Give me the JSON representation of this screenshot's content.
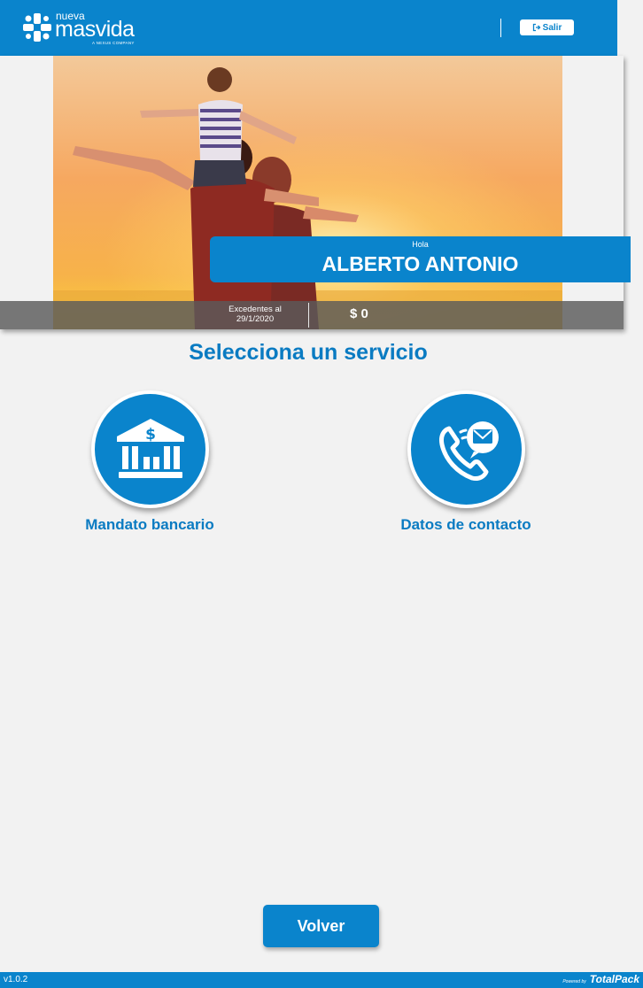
{
  "header": {
    "logo_small": "nueva",
    "logo_big": "masvida",
    "logo_tagline": "A NEXUS COMPANY",
    "logout_label": "Salir",
    "logout_icon": "sign-out-icon"
  },
  "hero": {
    "greeting": "Hola",
    "user_name": "ALBERTO ANTONIO",
    "balance_label_line1": "Excedentes al",
    "balance_label_line2": "29/1/2020",
    "balance_value": "$ 0"
  },
  "services": {
    "title": "Selecciona un servicio",
    "items": [
      {
        "label": "Mandato bancario",
        "icon": "bank-icon"
      },
      {
        "label": "Datos de contacto",
        "icon": "phone-mail-icon"
      }
    ]
  },
  "actions": {
    "back_label": "Volver"
  },
  "footer": {
    "version": "v1.0.2",
    "powered_by": "Powered by",
    "brand": "TotalPack"
  },
  "colors": {
    "primary": "#0a84cc",
    "title": "#0a7bc2",
    "background": "#f2f2f2"
  }
}
